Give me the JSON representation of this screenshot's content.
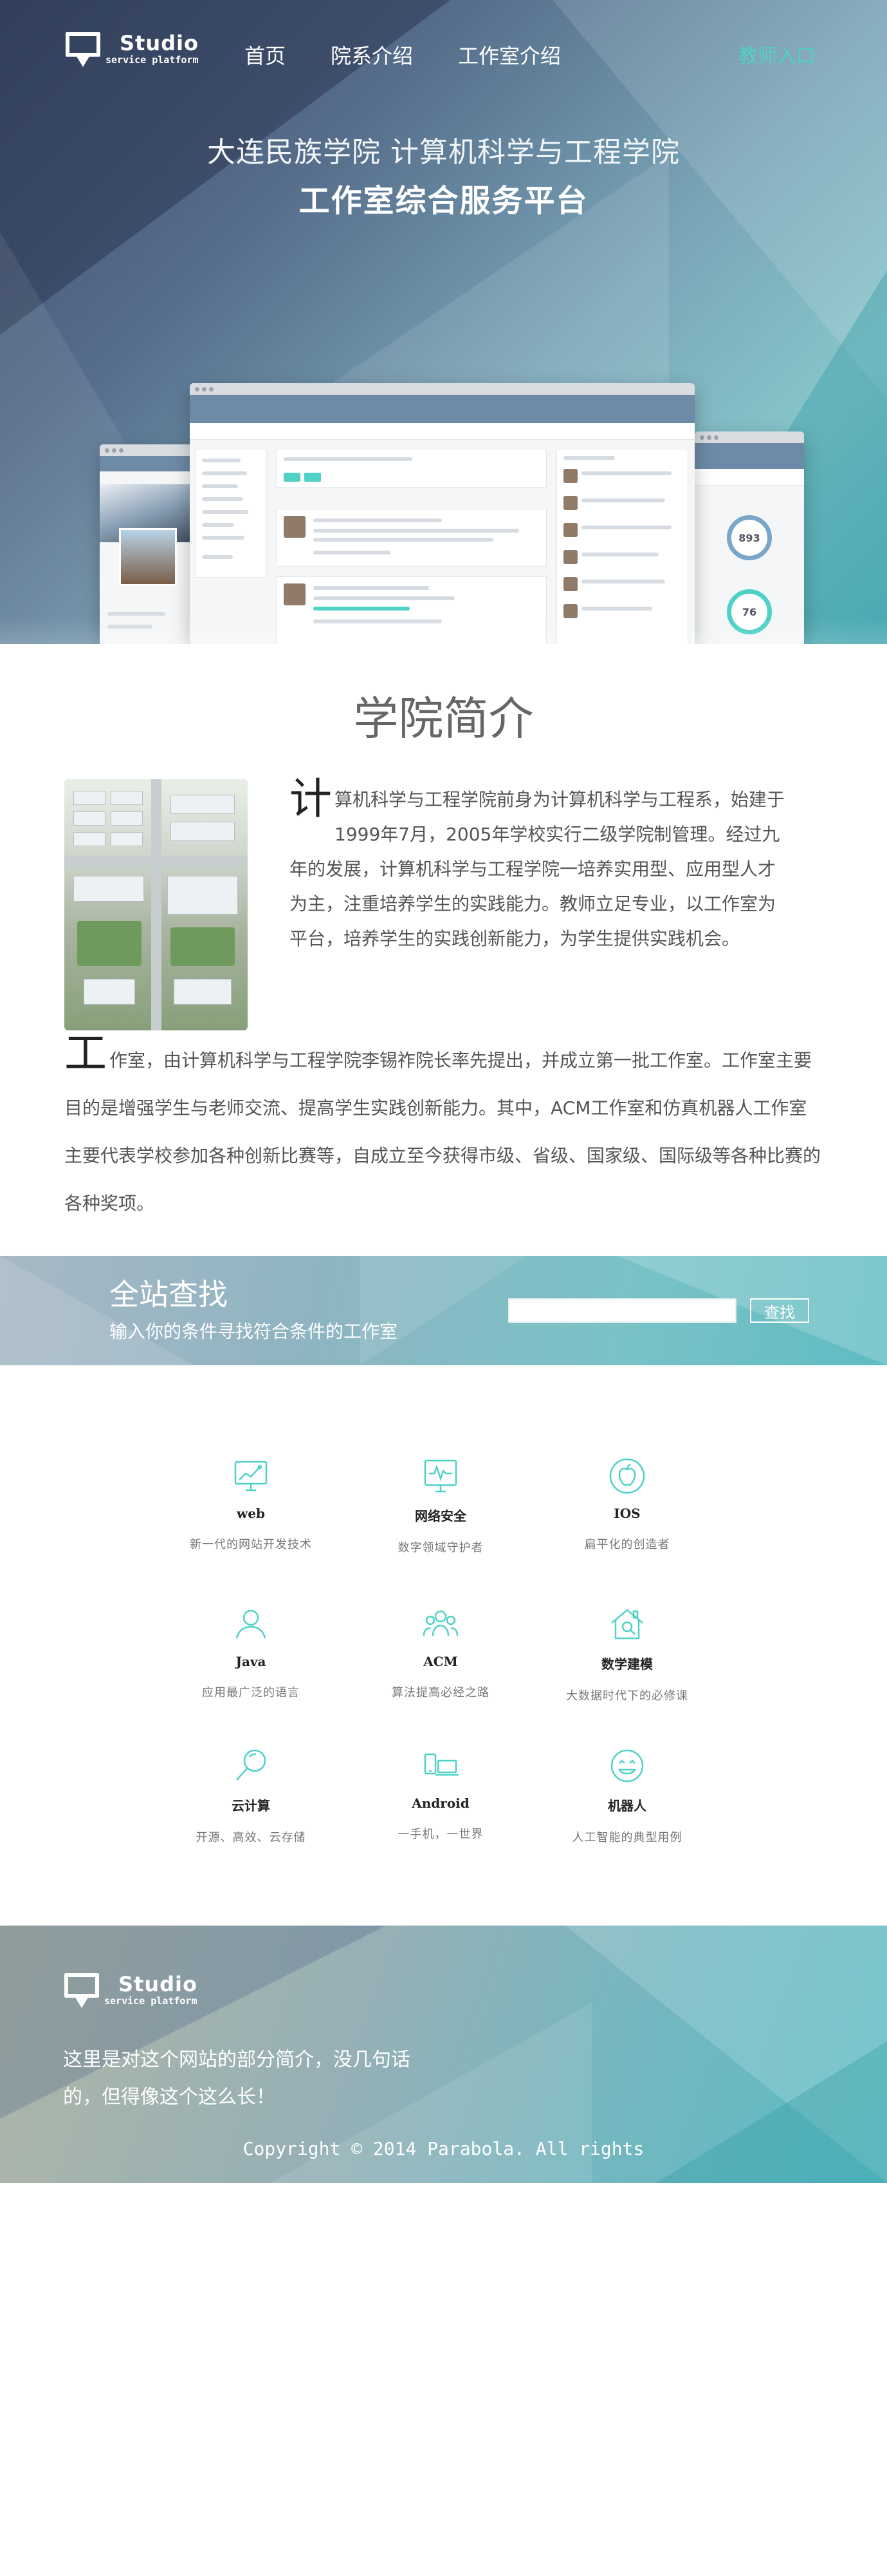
{
  "brand": {
    "title": "Studio",
    "subtitle": "service platform"
  },
  "nav": {
    "items": [
      "首页",
      "院系介绍",
      "工作室介绍"
    ],
    "teacher_link": "教师入口"
  },
  "hero": {
    "line1": "大连民族学院  计算机科学与工程学院",
    "line2": "工作室综合服务平台",
    "mock_gauge_total": "893",
    "mock_gauge_online": "76"
  },
  "intro": {
    "title": "学院简介",
    "para1_cap": "计",
    "para1": "算机科学与工程学院前身为计算机科学与工程系，始建于1999年7月，2005年学校实行二级学院制管理。经过九年的发展，计算机科学与工程学院一培养实用型、应用型人才为主，注重培养学生的实践能力。教师立足专业，以工作室为平台，培养学生的实践创新能力，为学生提供实践机会。",
    "para2_cap": "工",
    "para2": "作室，由计算机科学与工程学院李锡祚院长率先提出，并成立第一批工作室。工作室主要目的是增强学生与老师交流、提高学生实践创新能力。其中，ACM工作室和仿真机器人工作室主要代表学校参加各种创新比赛等，自成立至今获得市级、省级、国家级、国际级等各种比赛的各种奖项。"
  },
  "search": {
    "title": "全站查找",
    "subtitle": "输入你的条件寻找符合条件的工作室",
    "input_value": "",
    "input_placeholder": "",
    "button_label": "查找"
  },
  "features": [
    {
      "icon": "monitor-chart-icon",
      "title": "web",
      "subtitle": "新一代的网站开发技术"
    },
    {
      "icon": "pulse-screen-icon",
      "title": "网络安全",
      "subtitle": "数字领域守护者"
    },
    {
      "icon": "apple-icon",
      "title": "IOS",
      "subtitle": "扁平化的创造者"
    },
    {
      "icon": "user-icon",
      "title": "Java",
      "subtitle": "应用最广泛的语言"
    },
    {
      "icon": "users-icon",
      "title": "ACM",
      "subtitle": "算法提高必经之路"
    },
    {
      "icon": "house-search-icon",
      "title": "数学建模",
      "subtitle": "大数据时代下的必修课"
    },
    {
      "icon": "magnifier-icon",
      "title": "云计算",
      "subtitle": "开源、高效、云存储"
    },
    {
      "icon": "devices-icon",
      "title": "Android",
      "subtitle": "一手机，一世界"
    },
    {
      "icon": "smiley-icon",
      "title": "机器人",
      "subtitle": "人工智能的典型用例"
    }
  ],
  "footer": {
    "description": "这里是对这个网站的部分简介，没几句话的，但得像这个这么长！",
    "copyright": "Copyright © 2014 Parabola. All rights"
  },
  "colors": {
    "accent": "#4fd1c5",
    "hero_dark": "#3d4f6c",
    "teal": "#5bbcc4"
  }
}
